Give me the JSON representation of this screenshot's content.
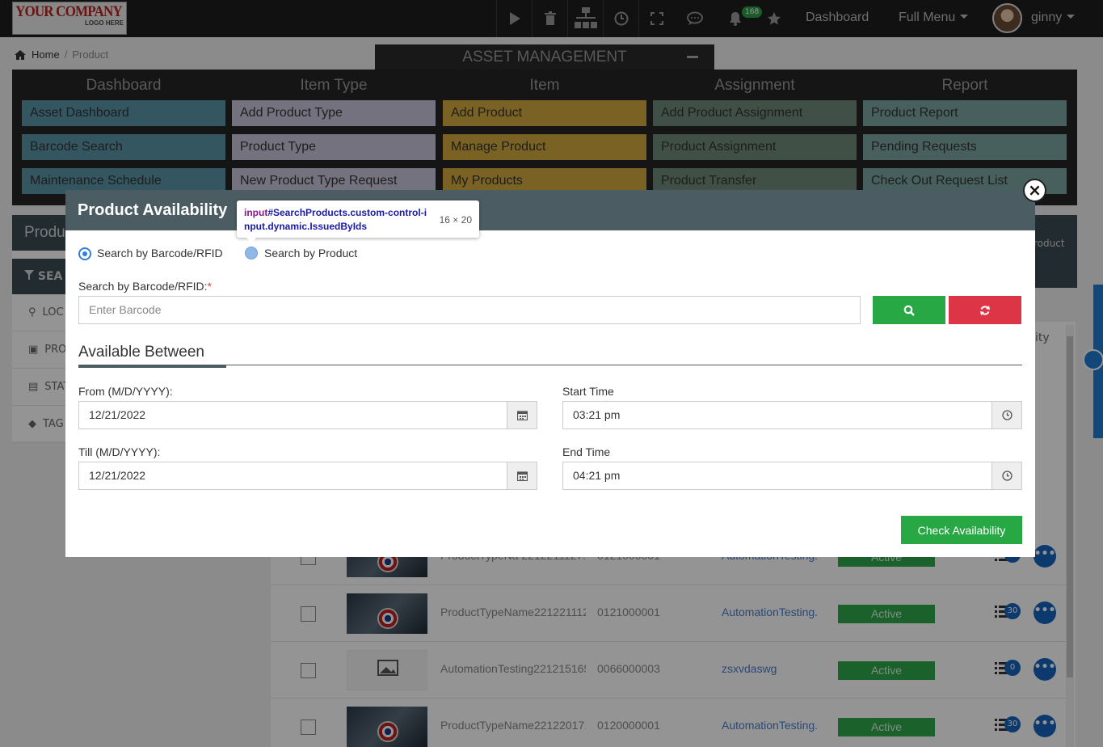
{
  "logo": {
    "line1": "YOUR COMPANY",
    "line2": "LOGO HERE"
  },
  "topbar": {
    "icons": [
      "play-icon",
      "trash-icon",
      "sitemap-icon",
      "clock-icon",
      "expand-icon",
      "comment-icon",
      "bell-icon",
      "star-icon"
    ],
    "notification_count": "168",
    "dashboard": "Dashboard",
    "full_menu": "Full Menu",
    "user": "ginny"
  },
  "breadcrumb": {
    "home": "Home",
    "sep": "/",
    "current": "Product"
  },
  "asset_tab": {
    "title": "ASSET MANAGEMENT"
  },
  "menu": {
    "dashboard": {
      "title": "Dashboard",
      "items": [
        "Asset Dashboard",
        "Barcode Search",
        "Maintenance Schedule"
      ]
    },
    "item_type": {
      "title": "Item Type",
      "items": [
        "Add Product Type",
        "Product Type",
        "New Product Type Request"
      ]
    },
    "item": {
      "title": "Item",
      "items": [
        "Add Product",
        "Manage Product",
        "My Products"
      ]
    },
    "assignment": {
      "title": "Assignment",
      "items": [
        "Add Product Assignment",
        "Product Assignment",
        "Product Transfer"
      ]
    },
    "report": {
      "title": "Report",
      "items": [
        "Product Report",
        "Pending Requests",
        "Check Out Request List"
      ]
    }
  },
  "left_panel": {
    "title": "Produ",
    "search": "SEA",
    "filters": [
      "LOC",
      "PRO",
      "STAT",
      "TAG"
    ]
  },
  "right_box": {
    "text": "roduct"
  },
  "table_header_partial": "ity",
  "table": {
    "rows": [
      {
        "name": "ProductTypeNa 2212211127.",
        "code": "0121000001",
        "link": "AutomationTesting.",
        "status": "Active",
        "count": "30",
        "image": "captain-america"
      },
      {
        "name": "ProductTypeName2212211127.",
        "code": "0121000001",
        "link": "AutomationTesting.",
        "status": "Active",
        "count": "30",
        "image": "captain-america"
      },
      {
        "name": "AutomationTesting221215165.",
        "code": "0066000003",
        "link": "zsxvdaswg",
        "status": "Active",
        "count": "0",
        "image": "image-not-available"
      },
      {
        "name": "ProductTypeName22122017.",
        "code": "0120000001",
        "link": "AutomationTesting.",
        "status": "Active",
        "count": "30",
        "image": "captain-america"
      }
    ]
  },
  "modal": {
    "title": "Product Availability",
    "radio_barcode": "Search by Barcode/RFID",
    "radio_product": "Search by Product",
    "barcode_label": "Search by Barcode/RFID:",
    "required_mark": "*",
    "barcode_placeholder": "Enter Barcode",
    "section_title": "Available Between",
    "from_label": "From (M/D/YYYY):",
    "from_value": "12/21/2022",
    "till_label": "Till (M/D/YYYY):",
    "till_value": "12/21/2022",
    "start_label": "Start Time",
    "start_value": "03:21 pm",
    "end_label": "End Time",
    "end_value": "04:21 pm",
    "check_button": "Check Availability",
    "colors": {
      "search": "#28a745",
      "reset": "#dc3545",
      "header": "#4b5c63"
    }
  },
  "devtools_tooltip": {
    "tag": "input",
    "selector": "#SearchProducts.custom-control-input.dynamic.IssuedByIds",
    "size": "16 × 20"
  }
}
